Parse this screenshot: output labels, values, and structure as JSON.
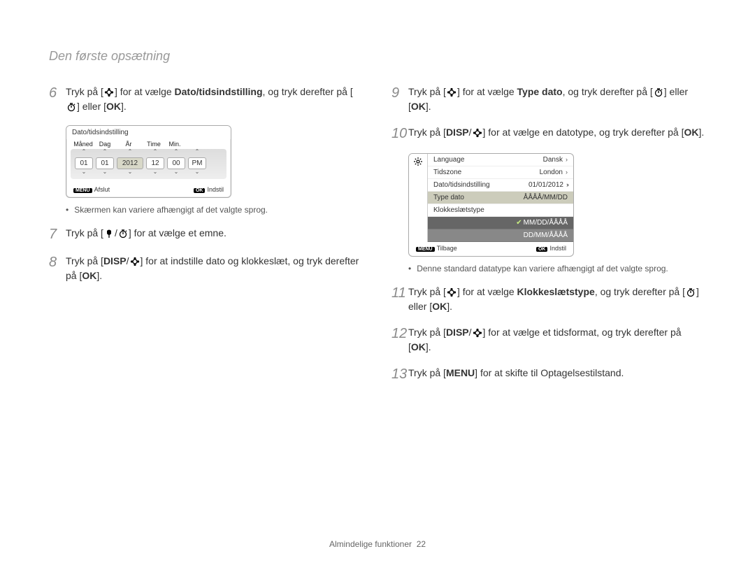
{
  "header": {
    "title": "Den første opsætning"
  },
  "left": {
    "step6": {
      "num": "6",
      "t1": "Tryk på [",
      "t2": "] for at vælge ",
      "bold": "Dato/tidsindstilling",
      "t3": ", og tryk derefter på [",
      "t4": "] eller [",
      "t5": "]."
    },
    "screenshot1": {
      "title": "Dato/tidsindstilling",
      "labels": {
        "l1": "Måned",
        "l2": "Dag",
        "l3": "År",
        "l4": "Time",
        "l5": "Min."
      },
      "vals": {
        "v1": "01",
        "v2": "01",
        "v3": "2012",
        "v4": "12",
        "v5": "00",
        "v6": "PM"
      },
      "footer_left_btn": "MENU",
      "footer_left": "Afslut",
      "footer_right_btn": "OK",
      "footer_right": "Indstil"
    },
    "note1": "Skærmen kan variere afhængigt af det valgte sprog.",
    "step7": {
      "num": "7",
      "t1": "Tryk på [",
      "t2": "/",
      "t3": "] for at vælge et emne."
    },
    "step8": {
      "num": "8",
      "t1": "Tryk på [",
      "disp": "DISP",
      "t2": "/",
      "t3": "] for at indstille dato og klokkeslæt, og tryk derefter på [",
      "t4": "]."
    }
  },
  "right": {
    "step9": {
      "num": "9",
      "t1": "Tryk på [",
      "t2": "] for at vælge ",
      "bold": "Type dato",
      "t3": ", og tryk derefter på [",
      "t4": "] eller [",
      "t5": "]."
    },
    "step10": {
      "num": "10",
      "t1": "Tryk på [",
      "disp": "DISP",
      "t2": "/",
      "t3": "] for at vælge en datotype, og tryk derefter på [",
      "t4": "]."
    },
    "screenshot2": {
      "rows": {
        "r1l": "Language",
        "r1r": "Dansk",
        "r2l": "Tidszone",
        "r2r": "London",
        "r3l": "Dato/tidsindstilling",
        "r3r": "01/01/2012",
        "r4l": "Type dato",
        "r4r": "ÅÅÅÅ/MM/DD",
        "r5l": "Klokkeslætstype"
      },
      "opts": {
        "o1": "MM/DD/ÅÅÅÅ",
        "o2": "DD/MM/ÅÅÅÅ"
      },
      "footer_left_btn": "MENU",
      "footer_left": "Tilbage",
      "footer_right_btn": "OK",
      "footer_right": "Indstil"
    },
    "note2": "Denne standard datatype kan variere afhængigt af det valgte sprog.",
    "step11": {
      "num": "11",
      "t1": "Tryk på [",
      "t2": "] for at vælge ",
      "bold": "Klokkeslætstype",
      "t3": ", og tryk derefter på [",
      "t4": "] eller [",
      "t5": "]."
    },
    "step12": {
      "num": "12",
      "t1": "Tryk på [",
      "disp": "DISP",
      "t2": "/",
      "t3": "] for at vælge et tidsformat, og tryk derefter på [",
      "t4": "]."
    },
    "step13": {
      "num": "13",
      "t1": "Tryk på [",
      "menu": "MENU",
      "t2": "] for at skifte til Optagelsestilstand."
    }
  },
  "footer": {
    "label": "Almindelige funktioner",
    "page": "22"
  },
  "labels": {
    "ok": "OK"
  }
}
